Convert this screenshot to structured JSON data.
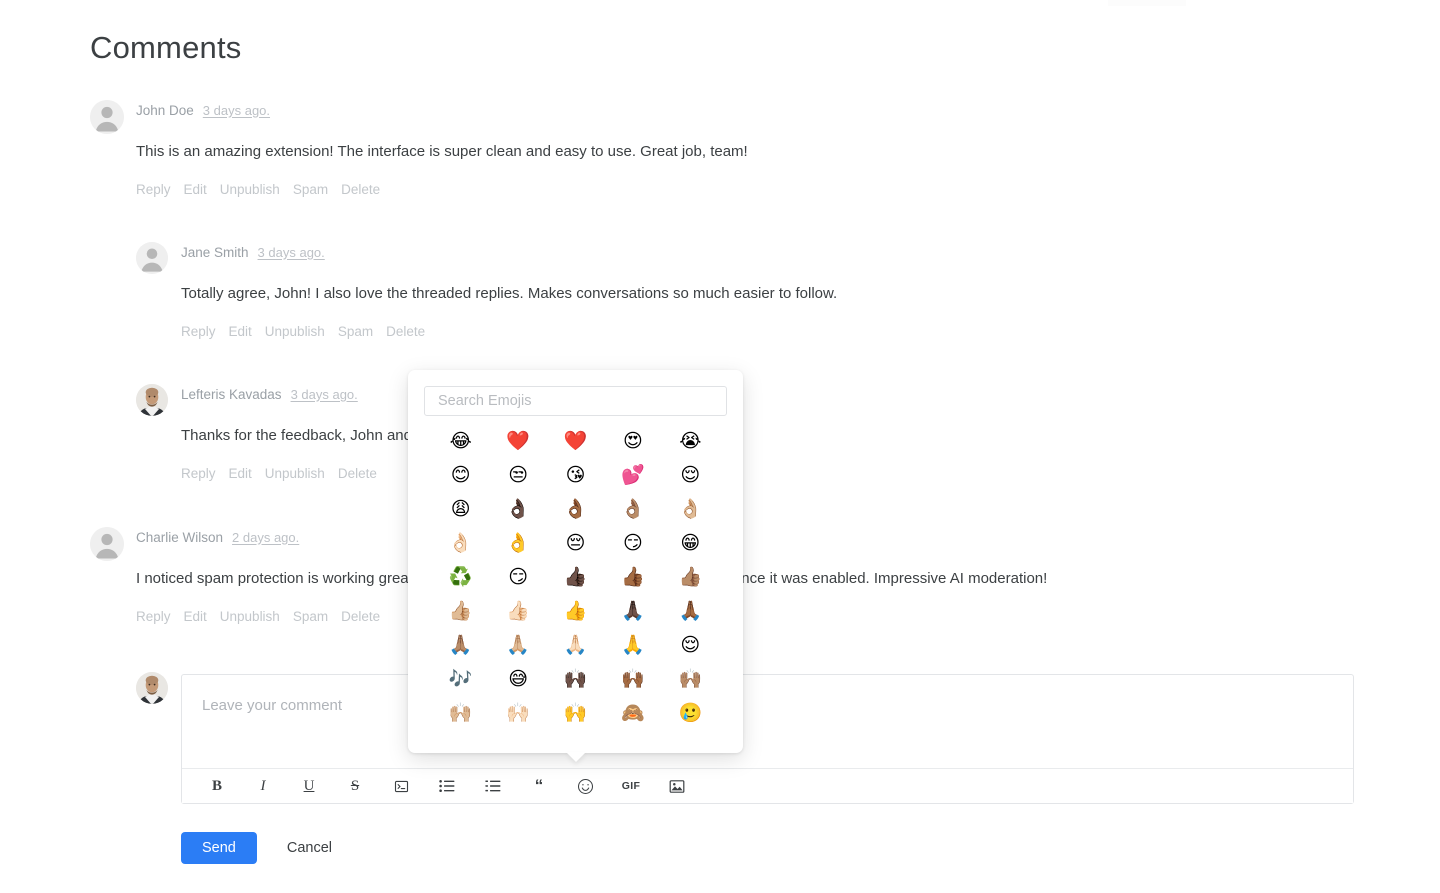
{
  "page": {
    "title": "Comments",
    "accent_color": "#2b7df5",
    "text_color": "#3c4043",
    "muted_color": "#9aa0a6"
  },
  "comments": [
    {
      "author": "John Doe",
      "timestamp": "3 days ago.",
      "body": "This is an amazing extension! The interface is super clean and easy to use. Great job, team!",
      "avatar": "placeholder",
      "actions": [
        "Reply",
        "Edit",
        "Unpublish",
        "Spam",
        "Delete"
      ]
    },
    {
      "author": "Jane Smith",
      "timestamp": "3 days ago.",
      "body": "Totally agree, John! I also love the threaded replies. Makes conversations so much easier to follow.",
      "avatar": "placeholder",
      "actions": [
        "Reply",
        "Edit",
        "Unpublish",
        "Spam",
        "Delete"
      ]
    },
    {
      "author": "Lefteris Kavadas",
      "timestamp": "3 days ago.",
      "body": "Thanks for the feedback, John and Jane! More features coming soon.",
      "avatar": "photo",
      "actions": [
        "Reply",
        "Edit",
        "Unpublish",
        "Delete"
      ]
    },
    {
      "author": "Charlie Wilson",
      "timestamp": "2 days ago.",
      "body": "I noticed spam protection is working great — not a single spam comment slipped through since it was enabled. Impressive AI moderation!",
      "avatar": "placeholder",
      "actions": [
        "Reply",
        "Edit",
        "Unpublish",
        "Spam",
        "Delete"
      ]
    }
  ],
  "composer": {
    "placeholder": "Leave your comment",
    "value": "",
    "avatar": "photo",
    "toolbar": [
      {
        "name": "bold",
        "label": "B",
        "kind": "text"
      },
      {
        "name": "italic",
        "label": "I",
        "kind": "text"
      },
      {
        "name": "underline",
        "label": "U",
        "kind": "text"
      },
      {
        "name": "strikethrough",
        "label": "S",
        "kind": "text"
      },
      {
        "name": "code-block",
        "label": "",
        "kind": "icon"
      },
      {
        "name": "bulleted-list",
        "label": "",
        "kind": "icon"
      },
      {
        "name": "numbered-list",
        "label": "",
        "kind": "icon"
      },
      {
        "name": "blockquote",
        "label": "“",
        "kind": "text"
      },
      {
        "name": "emoji",
        "label": "",
        "kind": "icon"
      },
      {
        "name": "gif",
        "label": "GIF",
        "kind": "text"
      },
      {
        "name": "image",
        "label": "",
        "kind": "icon"
      }
    ],
    "send_label": "Send",
    "cancel_label": "Cancel"
  },
  "emoji_picker": {
    "search_placeholder": "Search Emojis",
    "search_value": "",
    "open": true,
    "emojis": [
      "😂",
      "❤️",
      "❤️",
      "😍",
      "😭",
      "😊",
      "😒",
      "😘",
      "💕",
      "😌",
      "😩",
      "👌🏿",
      "👌🏾",
      "👌🏽",
      "👌🏼",
      "👌🏻",
      "👌",
      "😔",
      "😏",
      "😁",
      "♻️",
      "😏",
      "👍🏿",
      "👍🏾",
      "👍🏽",
      "👍🏼",
      "👍🏻",
      "👍",
      "🙏🏿",
      "🙏🏾",
      "🙏🏽",
      "🙏🏼",
      "🙏🏻",
      "🙏",
      "😌",
      "🎶",
      "😅",
      "🙌🏿",
      "🙌🏾",
      "🙌🏽",
      "🙌🏼",
      "🙌🏻",
      "🙌",
      "🙈",
      "🥲"
    ]
  }
}
